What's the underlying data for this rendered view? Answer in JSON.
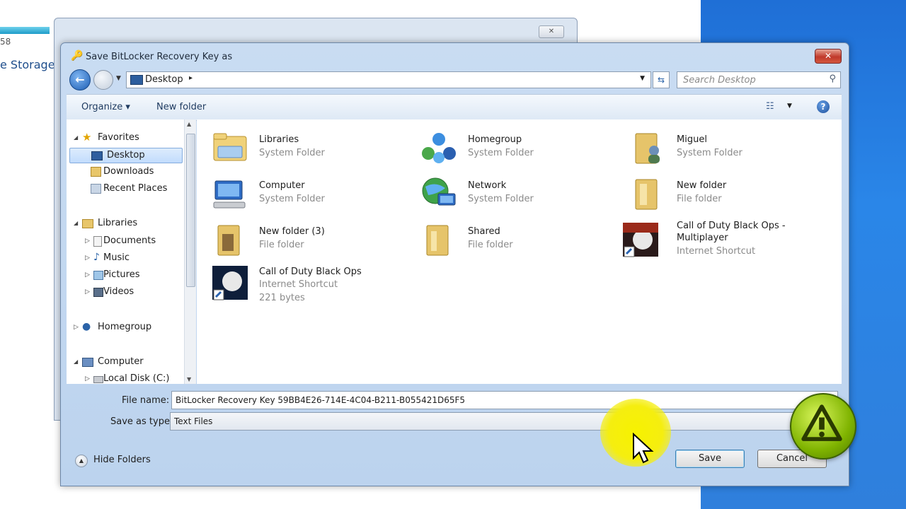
{
  "background": {
    "storage_label": "e Storage",
    "num_label": "58"
  },
  "dialog": {
    "title": "Save BitLocker Recovery Key as",
    "close_glyph": "✕",
    "address": {
      "location": "Desktop",
      "chevron": "▸"
    },
    "search": {
      "placeholder": "Search Desktop"
    },
    "toolbar": {
      "organize_label": "Organize ▾",
      "new_folder_label": "New folder",
      "help_glyph": "?"
    },
    "nav": {
      "items": [
        {
          "label": "Favorites"
        },
        {
          "label": "Desktop"
        },
        {
          "label": "Downloads"
        },
        {
          "label": "Recent Places"
        },
        {
          "label": "Libraries"
        },
        {
          "label": "Documents"
        },
        {
          "label": "Music"
        },
        {
          "label": "Pictures"
        },
        {
          "label": "Videos"
        },
        {
          "label": "Homegroup"
        },
        {
          "label": "Computer"
        },
        {
          "label": "Local Disk (C:)"
        }
      ]
    },
    "files": [
      {
        "name": "Libraries",
        "type": "System Folder"
      },
      {
        "name": "Homegroup",
        "type": "System Folder"
      },
      {
        "name": "Miguel",
        "type": "System Folder"
      },
      {
        "name": "Computer",
        "type": "System Folder"
      },
      {
        "name": "Network",
        "type": "System Folder"
      },
      {
        "name": "New folder",
        "type": "File folder"
      },
      {
        "name": "New folder (3)",
        "type": "File folder"
      },
      {
        "name": "Shared",
        "type": "File folder"
      },
      {
        "name": "Call of Duty Black Ops - Multiplayer",
        "type": "Internet Shortcut"
      },
      {
        "name": "Call of Duty Black Ops",
        "type": "Internet Shortcut",
        "size": "221 bytes"
      }
    ],
    "file_name": {
      "label": "File name:",
      "value": "BitLocker Recovery Key 59BB4E26-714E-4C04-B211-B055421D65F5"
    },
    "save_type": {
      "label": "Save as type:",
      "value": "Text Files"
    },
    "hide_folders_label": "Hide Folders",
    "save_label": "Save",
    "cancel_label": "Cancel"
  },
  "colors": {
    "accent": "#1c5db3",
    "warning_green": "#7fb300",
    "highlight_yellow": "#f5ee10"
  }
}
